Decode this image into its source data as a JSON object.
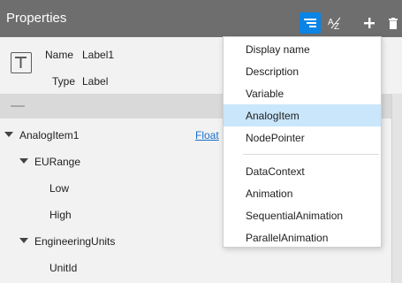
{
  "panel": {
    "title": "Properties"
  },
  "toolbar": {
    "icons": [
      "filter-list-icon",
      "sort-az-icon",
      "plus-icon",
      "trash-icon"
    ],
    "sort_label": "AZ"
  },
  "header": {
    "name_label": "Name",
    "name_value": "Label1",
    "type_label": "Type",
    "type_value": "Label"
  },
  "tree": {
    "rows": [
      {
        "label": "AnalogItem1",
        "expanded": true,
        "value": "Float"
      },
      {
        "label": "EURange",
        "expanded": true
      },
      {
        "label": "Low"
      },
      {
        "label": "High"
      },
      {
        "label": "EngineeringUnits",
        "expanded": true
      },
      {
        "label": "UnitId"
      }
    ]
  },
  "menu": {
    "group1": [
      "Display name",
      "Description",
      "Variable",
      "AnalogItem",
      "NodePointer"
    ],
    "group2": [
      "DataContext",
      "Animation",
      "SequentialAnimation",
      "ParallelAnimation"
    ],
    "selected": "AnalogItem"
  },
  "colors": {
    "title_bar": "#6e6e6e",
    "active_button": "#0a84e6",
    "menu_selected": "#c9e6fb",
    "link": "#1a6fcc"
  }
}
